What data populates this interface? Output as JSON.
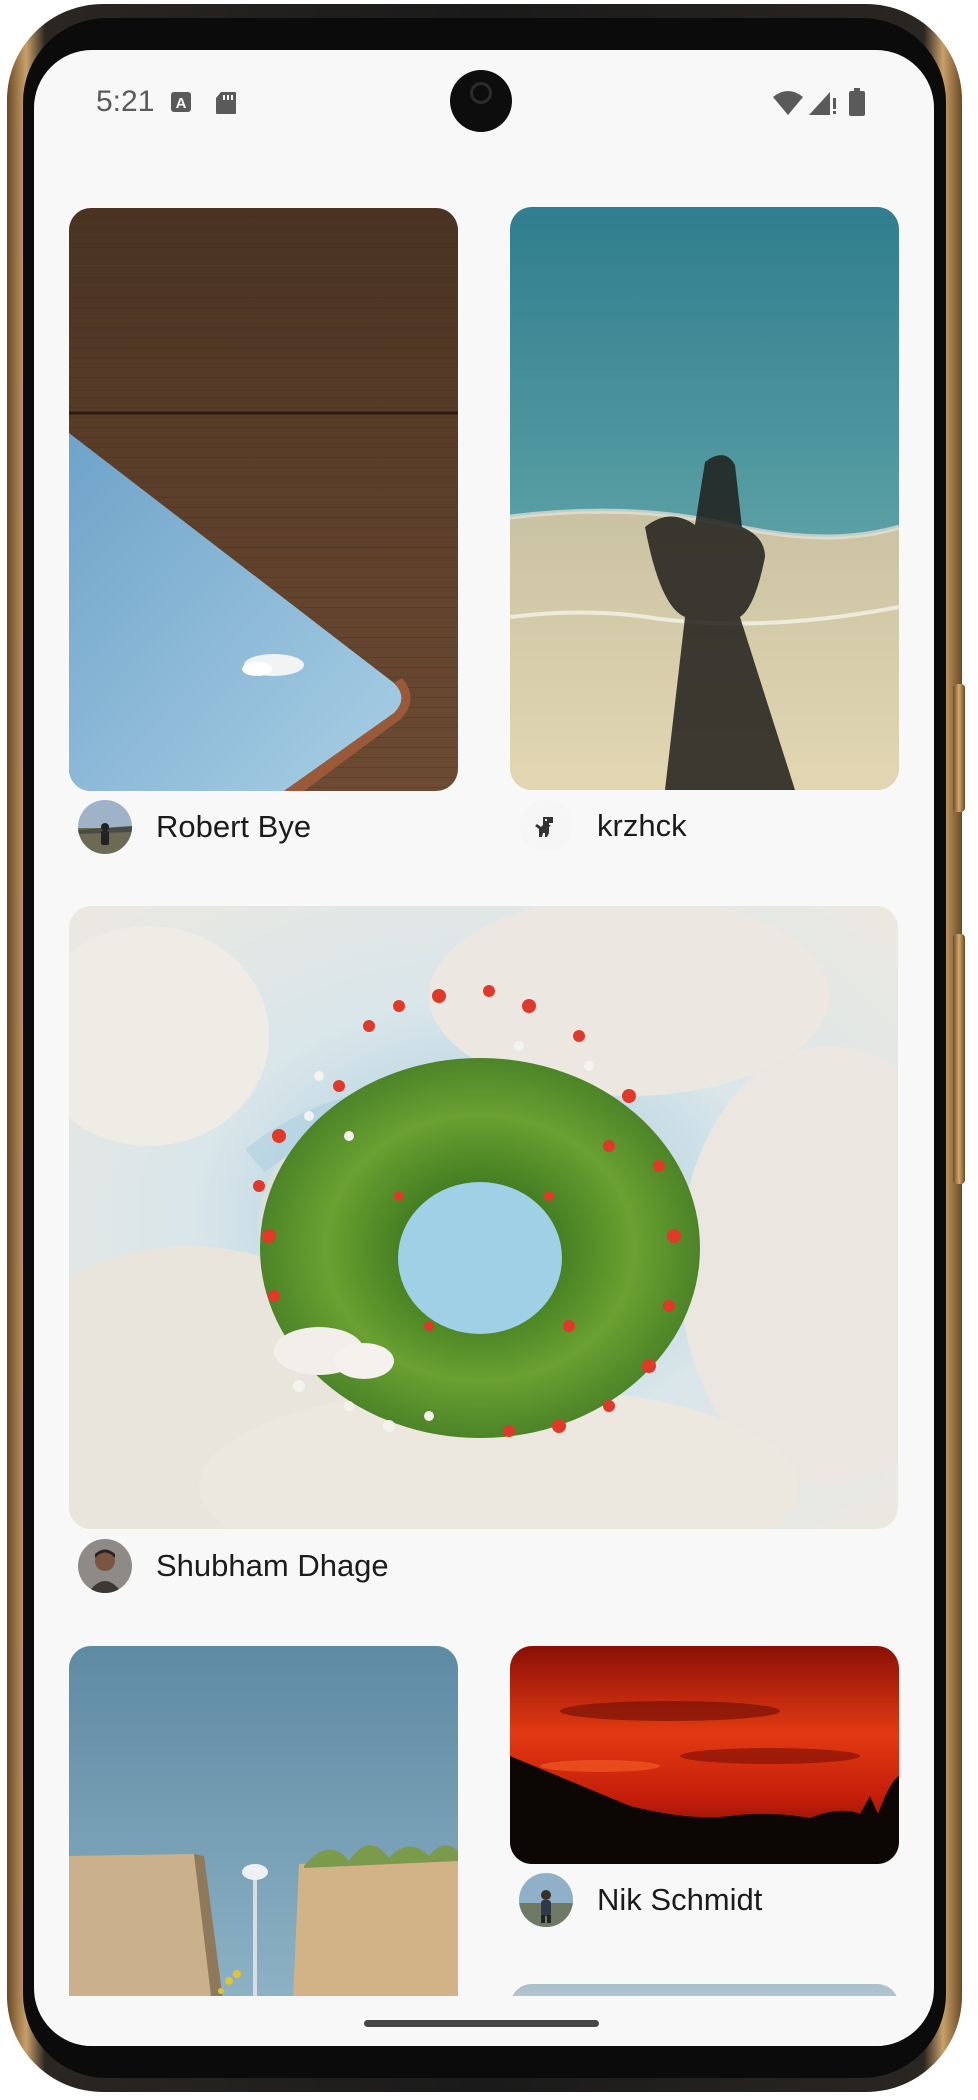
{
  "status_bar": {
    "time": "5:21",
    "left_icons": [
      "text-a-notification-icon",
      "sd-card-icon"
    ],
    "right_icons": [
      "wifi-icon",
      "cellular-signal-icon",
      "battery-icon"
    ]
  },
  "feed": {
    "items": [
      {
        "author": "Robert Bye",
        "avatar": "avatar-person-road",
        "photo": "wood-building-sky-photo"
      },
      {
        "author": "krzhck",
        "avatar": "avatar-dinosaur",
        "photo": "beach-shadow-photo"
      },
      {
        "author": "Shubham Dhage",
        "avatar": "avatar-person-portrait",
        "photo": "flower-ring-clouds-photo"
      },
      {
        "author": "",
        "avatar": "",
        "photo": "walls-lamppost-sky-photo"
      },
      {
        "author": "Nik Schmidt",
        "avatar": "avatar-person-hiker",
        "photo": "red-sunset-silhouette-photo"
      }
    ]
  },
  "colors": {
    "screen_bg": "#f8f8f8",
    "text": "#1b1b1b",
    "status_text": "#5a5a5a"
  }
}
